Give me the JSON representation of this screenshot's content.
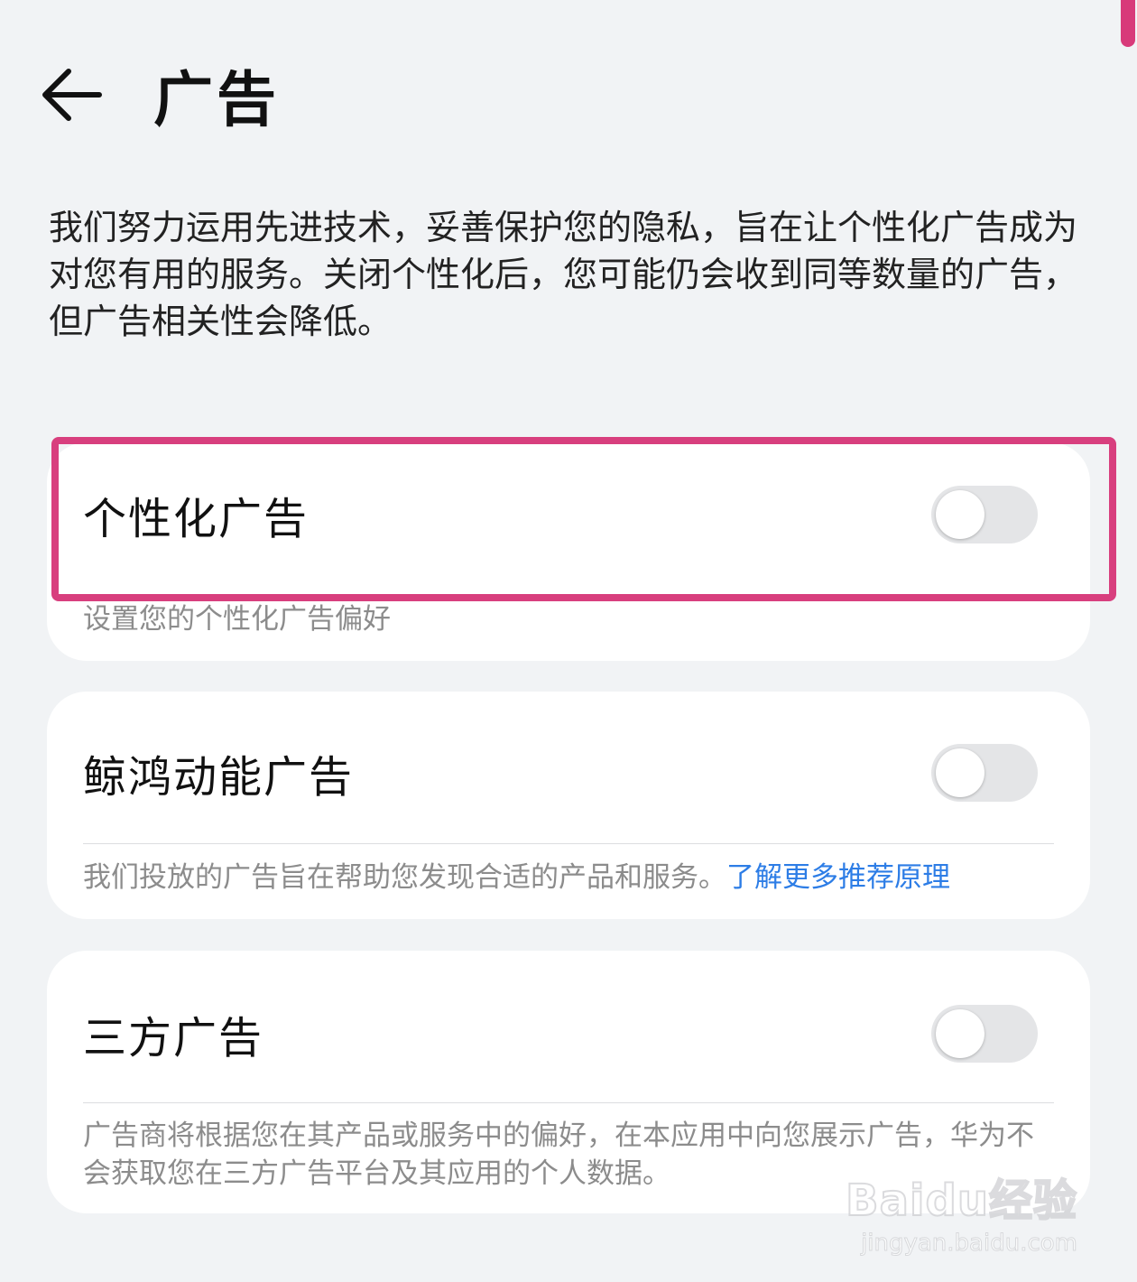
{
  "header": {
    "title": "广告",
    "back_icon": "arrow-left-icon"
  },
  "intro": {
    "text": "我们努力运用先进技术，妥善保护您的隐私，旨在让个性化广告成为对您有用的服务。关闭个性化后，您可能仍会收到同等数量的广告，但广告相关性会降低。"
  },
  "settings": [
    {
      "label": "个性化广告",
      "description": "设置您的个性化广告偏好",
      "enabled": false
    },
    {
      "label": "鲸鸿动能广告",
      "description": "我们投放的广告旨在帮助您发现合适的产品和服务。",
      "link": "了解更多推荐原理",
      "enabled": false
    },
    {
      "label": "三方广告",
      "description": "广告商将根据您在其产品或服务中的偏好，在本应用中向您展示广告，华为不会获取您在三方广告平台及其应用的个人数据。",
      "enabled": false
    }
  ],
  "watermark": {
    "main": "Baidu经验",
    "sub": "jingyan.baidu.com"
  },
  "colors": {
    "background": "#f1f3f5",
    "card": "#ffffff",
    "highlight": "#d83f7e",
    "link": "#2d7de6",
    "toggle_off": "#e4e5e7"
  }
}
